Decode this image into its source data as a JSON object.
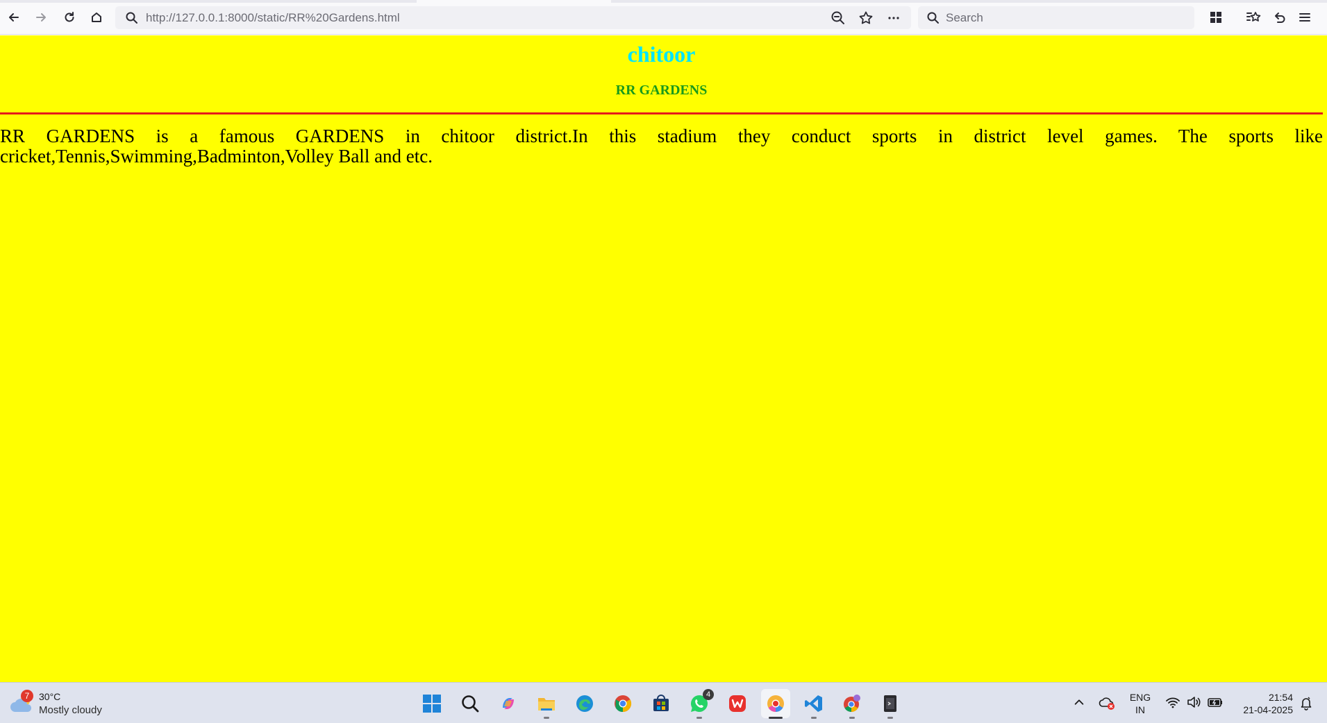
{
  "browser": {
    "url_host": "http://127.0.0.1",
    "url_rest": ":8000/static/RR%20Gardens.html",
    "search_placeholder": "Search"
  },
  "page": {
    "title": "chitoor",
    "subtitle": "RR GARDENS",
    "paragraph": "RR GARDENS is a famous GARDENS in chitoor district.In this stadium they conduct sports in district level games. The sports like cricket,Tennis,Swimming,Badminton,Volley Ball and etc.",
    "background_color": "#ffff00",
    "title_color": "#00e5ff",
    "subtitle_color": "#1a9a1a",
    "rule_color": "#e51b1b"
  },
  "taskbar": {
    "weather": {
      "badge": "7",
      "temperature": "30°C",
      "condition": "Mostly cloudy"
    },
    "apps": [
      {
        "name": "windows-start",
        "icon": "windows-logo-icon"
      },
      {
        "name": "search",
        "icon": "search-icon"
      },
      {
        "name": "copilot",
        "icon": "copilot-icon"
      },
      {
        "name": "file-explorer",
        "icon": "folder-icon"
      },
      {
        "name": "edge",
        "icon": "edge-icon"
      },
      {
        "name": "chrome",
        "icon": "chrome-icon"
      },
      {
        "name": "microsoft-store",
        "icon": "store-icon"
      },
      {
        "name": "whatsapp",
        "icon": "whatsapp-icon",
        "badge": "4"
      },
      {
        "name": "wps-office",
        "icon": "wps-icon"
      },
      {
        "name": "chrome-canary",
        "icon": "chrome-canary-icon"
      },
      {
        "name": "vscode",
        "icon": "vscode-icon"
      },
      {
        "name": "chrome-profile",
        "icon": "chrome-profile-icon"
      },
      {
        "name": "terminal-app",
        "icon": "terminal-icon"
      }
    ],
    "language_line1": "ENG",
    "language_line2": "IN",
    "time": "21:54",
    "date": "21-04-2025"
  }
}
